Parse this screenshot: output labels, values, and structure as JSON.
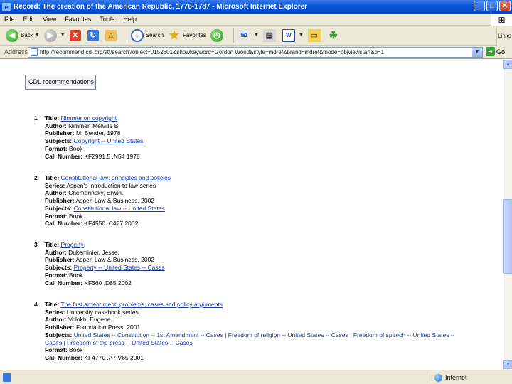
{
  "window": {
    "title": "Record: The creation of the American Republic, 1776-1787 - Microsoft Internet Explorer",
    "buttons": {
      "minimize": "_",
      "maximize": "□",
      "close": "✕"
    }
  },
  "menu": [
    "File",
    "Edit",
    "View",
    "Favorites",
    "Tools",
    "Help"
  ],
  "toolbar": {
    "back_label": "Back",
    "search_label": "Search",
    "favorites_label": "Favorites",
    "right_label": "Links"
  },
  "address": {
    "label": "Address",
    "url": "http://recommend.cdl.org/stf/search?object=0152601&showkeyword=Gordon Wood&style=mdref&brand=mdref&mode=objviewstart&b=1",
    "go_label": "Go"
  },
  "content": {
    "cd_button_label": "CDL recommendations",
    "records": [
      {
        "num": "1",
        "fields": [
          {
            "label": "Title:",
            "value": "Nimmer on copyright",
            "link": true
          },
          {
            "label": "Author:",
            "value": "Nimmer, Melville B.",
            "link": false
          },
          {
            "label": "Publisher:",
            "value": "M. Bender, 1978",
            "link": false
          },
          {
            "label": "Subjects:",
            "value": "Copyright -- United States",
            "link": true
          },
          {
            "label": "Format:",
            "value": "Book",
            "link": false
          },
          {
            "label": "Call Number:",
            "value": "KF2991.5 .N54 1978",
            "link": false
          }
        ]
      },
      {
        "num": "2",
        "fields": [
          {
            "label": "Title:",
            "value": "Constitutional law: principles and policies",
            "link": true
          },
          {
            "label": "Series:",
            "value": "Aspen's introduction to law series",
            "link": false
          },
          {
            "label": "Author:",
            "value": "Chemerinsky, Erwin.",
            "link": false
          },
          {
            "label": "Publisher:",
            "value": "Aspen Law & Business, 2002",
            "link": false
          },
          {
            "label": "Subjects:",
            "value": "Constitutional law -- United States",
            "link": true
          },
          {
            "label": "Format:",
            "value": "Book",
            "link": false
          },
          {
            "label": "Call Number:",
            "value": "KF4550 .C427 2002",
            "link": false
          }
        ]
      },
      {
        "num": "3",
        "fields": [
          {
            "label": "Title:",
            "value": "Property",
            "link": true
          },
          {
            "label": "Author:",
            "value": "Dukeminier, Jesse.",
            "link": false
          },
          {
            "label": "Publisher:",
            "value": "Aspen Law & Business, 2002",
            "link": false
          },
          {
            "label": "Subjects:",
            "value": "Property -- United States -- Cases",
            "link": true
          },
          {
            "label": "Format:",
            "value": "Book",
            "link": false
          },
          {
            "label": "Call Number:",
            "value": "KF560 .D85 2002",
            "link": false
          }
        ]
      },
      {
        "num": "4",
        "fields": [
          {
            "label": "Title:",
            "value": "The first amendment: problems, cases and policy arguments",
            "link": true
          },
          {
            "label": "Series:",
            "value": "University casebook series",
            "link": false
          },
          {
            "label": "Author:",
            "value": "Volokh, Eugene.",
            "link": false
          },
          {
            "label": "Publisher:",
            "value": "Foundation Press, 2001",
            "link": false
          },
          {
            "label": "Subjects:",
            "value": "United States -- Constitution -- 1st Amendment -- Cases | Freedom of religion -- United States -- Cases | Freedom of speech -- United States -- Cases | Freedom of the press -- United States -- Cases",
            "link": false,
            "plain_link": true
          },
          {
            "label": "Format:",
            "value": "Book",
            "link": false
          },
          {
            "label": "Call Number:",
            "value": "KF4770 .A7 V65 2001",
            "link": false
          }
        ]
      }
    ]
  },
  "status": {
    "zone_label": "Internet"
  },
  "colors": {
    "titlebar": "#0a58dc",
    "chrome": "#ece9d8",
    "link": "#1a3a9a"
  }
}
